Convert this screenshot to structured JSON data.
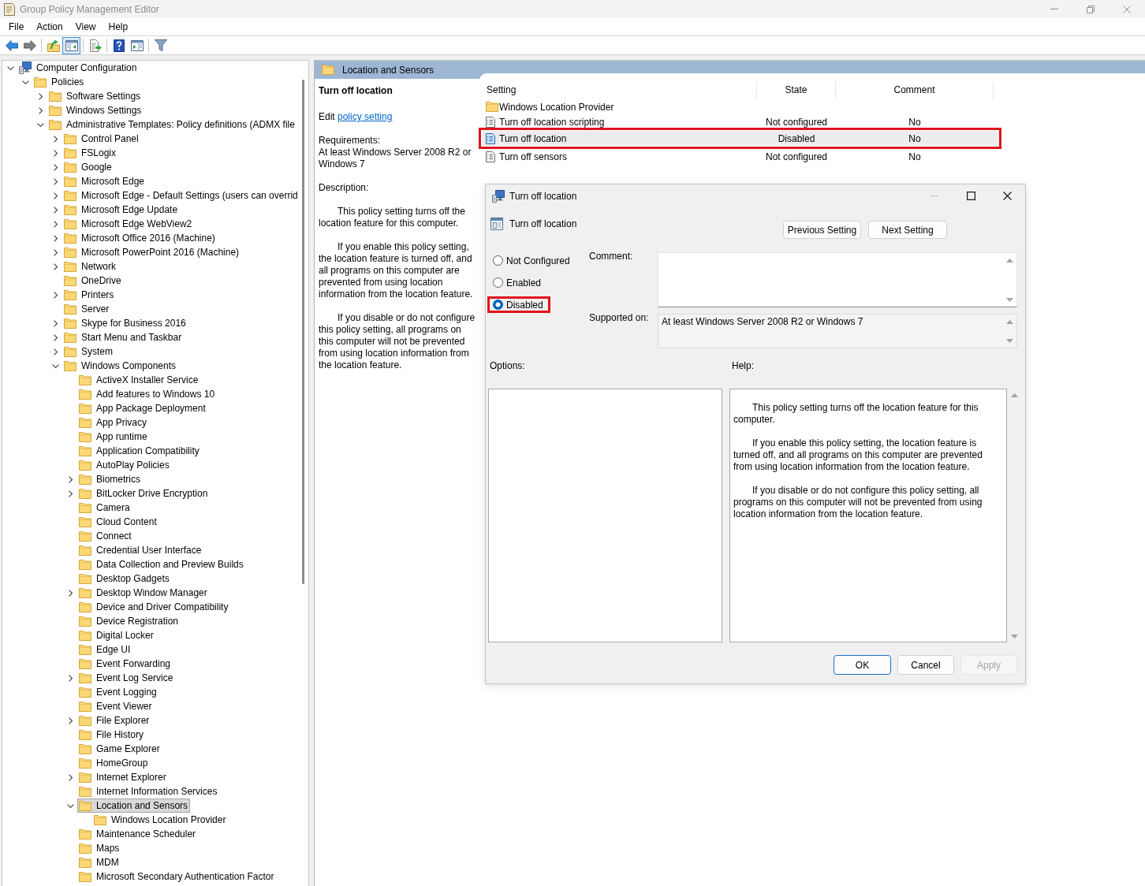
{
  "window": {
    "title": "Group Policy Management Editor"
  },
  "menu": [
    "File",
    "Action",
    "View",
    "Help"
  ],
  "toolbar": [
    {
      "kind": "back",
      "disabled": false,
      "pressed": false
    },
    {
      "kind": "forward",
      "disabled": true,
      "pressed": false
    },
    {
      "kind": "separator"
    },
    {
      "kind": "up",
      "disabled": false,
      "pressed": false
    },
    {
      "kind": "console_tree",
      "disabled": false,
      "pressed": true
    },
    {
      "kind": "separator"
    },
    {
      "kind": "export",
      "disabled": false,
      "pressed": false
    },
    {
      "kind": "separator"
    },
    {
      "kind": "help",
      "disabled": false,
      "pressed": false
    },
    {
      "kind": "action_pane",
      "disabled": false,
      "pressed": false
    },
    {
      "kind": "separator"
    },
    {
      "kind": "filter",
      "disabled": false,
      "pressed": false
    }
  ],
  "tree": [
    {
      "label": "Computer Configuration",
      "expanded": true,
      "selected": false,
      "children": [
        {
          "label": "Policies",
          "expanded": true,
          "selected": false,
          "children": [
            {
              "label": "Software Settings",
              "expanded": false,
              "selected": false
            },
            {
              "label": "Windows Settings",
              "expanded": false,
              "selected": false
            },
            {
              "label": "Administrative Templates: Policy definitions (ADMX file",
              "expanded": true,
              "selected": false,
              "children": [
                {
                  "label": "Control Panel",
                  "expanded": false,
                  "selected": false
                },
                {
                  "label": "FSLogix",
                  "expanded": false,
                  "selected": false
                },
                {
                  "label": "Google",
                  "expanded": false,
                  "selected": false
                },
                {
                  "label": "Microsoft Edge",
                  "expanded": false,
                  "selected": false
                },
                {
                  "label": "Microsoft Edge - Default Settings (users can overrid",
                  "expanded": false,
                  "selected": false
                },
                {
                  "label": "Microsoft Edge Update",
                  "expanded": false,
                  "selected": false
                },
                {
                  "label": "Microsoft Edge WebView2",
                  "expanded": false,
                  "selected": false
                },
                {
                  "label": "Microsoft Office 2016 (Machine)",
                  "expanded": false,
                  "selected": false
                },
                {
                  "label": "Microsoft PowerPoint 2016 (Machine)",
                  "expanded": false,
                  "selected": false
                },
                {
                  "label": "Network",
                  "expanded": false,
                  "selected": false
                },
                {
                  "label": "OneDrive",
                  "selected": false
                },
                {
                  "label": "Printers",
                  "expanded": false,
                  "selected": false
                },
                {
                  "label": "Server",
                  "selected": false
                },
                {
                  "label": "Skype for Business 2016",
                  "expanded": false,
                  "selected": false
                },
                {
                  "label": "Start Menu and Taskbar",
                  "expanded": false,
                  "selected": false
                },
                {
                  "label": "System",
                  "expanded": false,
                  "selected": false
                },
                {
                  "label": "Windows Components",
                  "expanded": true,
                  "selected": false,
                  "children": [
                    {
                      "label": "ActiveX Installer Service",
                      "selected": false
                    },
                    {
                      "label": "Add features to Windows 10",
                      "selected": false
                    },
                    {
                      "label": "App Package Deployment",
                      "selected": false
                    },
                    {
                      "label": "App Privacy",
                      "selected": false
                    },
                    {
                      "label": "App runtime",
                      "selected": false
                    },
                    {
                      "label": "Application Compatibility",
                      "selected": false
                    },
                    {
                      "label": "AutoPlay Policies",
                      "selected": false
                    },
                    {
                      "label": "Biometrics",
                      "expanded": false,
                      "selected": false
                    },
                    {
                      "label": "BitLocker Drive Encryption",
                      "expanded": false,
                      "selected": false
                    },
                    {
                      "label": "Camera",
                      "selected": false
                    },
                    {
                      "label": "Cloud Content",
                      "selected": false
                    },
                    {
                      "label": "Connect",
                      "selected": false
                    },
                    {
                      "label": "Credential User Interface",
                      "selected": false
                    },
                    {
                      "label": "Data Collection and Preview Builds",
                      "selected": false
                    },
                    {
                      "label": "Desktop Gadgets",
                      "selected": false
                    },
                    {
                      "label": "Desktop Window Manager",
                      "expanded": false,
                      "selected": false
                    },
                    {
                      "label": "Device and Driver Compatibility",
                      "selected": false
                    },
                    {
                      "label": "Device Registration",
                      "selected": false
                    },
                    {
                      "label": "Digital Locker",
                      "selected": false
                    },
                    {
                      "label": "Edge UI",
                      "selected": false
                    },
                    {
                      "label": "Event Forwarding",
                      "selected": false
                    },
                    {
                      "label": "Event Log Service",
                      "expanded": false,
                      "selected": false
                    },
                    {
                      "label": "Event Logging",
                      "selected": false
                    },
                    {
                      "label": "Event Viewer",
                      "selected": false
                    },
                    {
                      "label": "File Explorer",
                      "expanded": false,
                      "selected": false
                    },
                    {
                      "label": "File History",
                      "selected": false
                    },
                    {
                      "label": "Game Explorer",
                      "selected": false
                    },
                    {
                      "label": "HomeGroup",
                      "selected": false
                    },
                    {
                      "label": "Internet Explorer",
                      "expanded": false,
                      "selected": false
                    },
                    {
                      "label": "Internet Information Services",
                      "selected": false
                    },
                    {
                      "label": "Location and Sensors",
                      "expanded": true,
                      "selected": true,
                      "children": [
                        {
                          "label": "Windows Location Provider",
                          "selected": false
                        }
                      ]
                    },
                    {
                      "label": "Maintenance Scheduler",
                      "selected": false
                    },
                    {
                      "label": "Maps",
                      "selected": false
                    },
                    {
                      "label": "MDM",
                      "selected": false
                    },
                    {
                      "label": "Microsoft Secondary Authentication Factor",
                      "selected": false
                    }
                  ]
                }
              ]
            }
          ]
        }
      ]
    }
  ],
  "details": {
    "header": "Location and Sensors",
    "description": {
      "title": "Turn off location",
      "edit_prefix": "Edit",
      "edit_link": "policy setting",
      "requirements_label": "Requirements:",
      "requirements": "At least Windows Server 2008 R2 or Windows 7",
      "description_label": "Description:",
      "paragraphs": [
        "This policy setting turns off the location feature for this computer.",
        "If you enable this policy setting, the location feature is turned off, and all programs on this computer are prevented from using location information from the location feature.",
        "If you disable or do not configure this policy setting, all programs on this computer will not be prevented from using location information from the location feature."
      ]
    },
    "table": {
      "columns": [
        "Setting",
        "State",
        "Comment"
      ],
      "rows": [
        {
          "kind": "folder",
          "setting": "Windows Location Provider",
          "selected": false,
          "highlighted": false
        },
        {
          "kind": "policy",
          "setting": "Turn off location scripting",
          "state": "Not configured",
          "comment": "No",
          "selected": false,
          "highlighted": false
        },
        {
          "kind": "policy",
          "setting": "Turn off location",
          "state": "Disabled",
          "comment": "No",
          "selected": true,
          "highlighted": true
        },
        {
          "kind": "policy",
          "setting": "Turn off sensors",
          "state": "Not configured",
          "comment": "No",
          "selected": false,
          "highlighted": false
        }
      ]
    }
  },
  "dialog": {
    "title": "Turn off location",
    "minimize": {
      "disabled": true
    },
    "setting_name": "Turn off location",
    "nav_buttons": [
      "Previous Setting",
      "Next Setting"
    ],
    "options": [
      {
        "label": "Not Configured",
        "selected": false,
        "highlighted": false
      },
      {
        "label": "Enabled",
        "selected": false,
        "highlighted": false
      },
      {
        "label": "Disabled",
        "selected": true,
        "highlighted": true
      }
    ],
    "comment_label": "Comment:",
    "supported_label": "Supported on:",
    "supported_value": "At least Windows Server 2008 R2 or Windows 7",
    "options_label": "Options:",
    "help_label": "Help:",
    "help_paragraphs": [
      "This policy setting turns off the location feature for this computer.",
      "If you enable this policy setting, the location feature is turned off, and all programs on this computer are prevented from using location information from the location feature.",
      "If you disable or do not configure this policy setting, all programs on this computer will not be prevented from using location information from the location feature."
    ],
    "buttons": [
      {
        "label": "OK",
        "default": true,
        "disabled": false
      },
      {
        "label": "Cancel",
        "default": false,
        "disabled": false
      },
      {
        "label": "Apply",
        "default": false,
        "disabled": true
      }
    ]
  }
}
